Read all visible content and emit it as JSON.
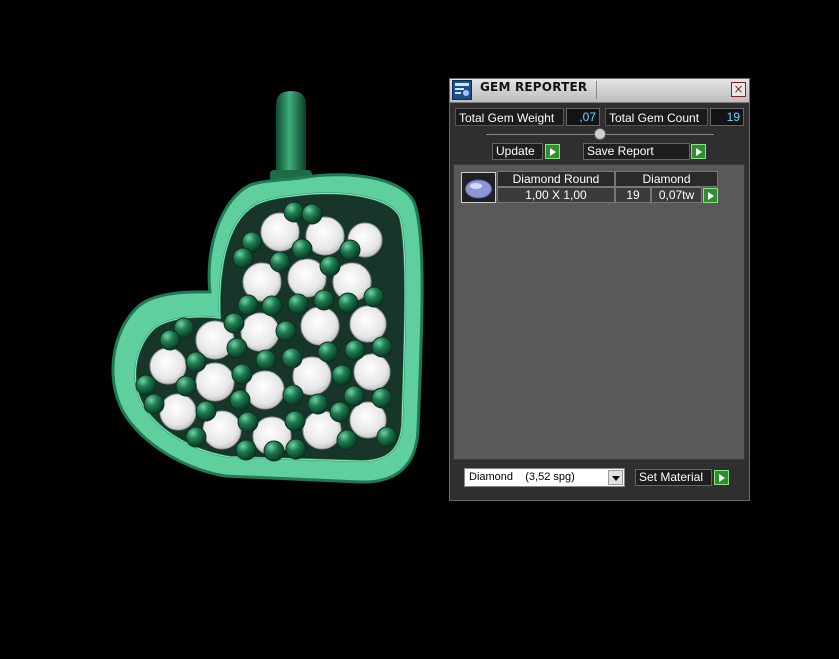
{
  "panel": {
    "title": "GEM REPORTER",
    "close_label": "×",
    "total_gem_weight_label": "Total Gem Weight",
    "total_gem_weight_value": ",07",
    "total_gem_count_label": "Total Gem Count",
    "total_gem_count_value": "19",
    "update_label": "Update",
    "save_report_label": "Save Report",
    "gem_table": {
      "headers": [
        "Diamond Round",
        "Diamond"
      ],
      "rows": [
        {
          "size": "1,00 X 1,00",
          "count": "19",
          "weight": "0,07tw"
        }
      ]
    },
    "material_select_value": "Diamond    (3,52 spg)",
    "set_material_label": "Set Material"
  },
  "viewport": {
    "metal_color": "#5fcf9f",
    "metal_dark": "#1f7a55",
    "bead_color": "#1e6a45",
    "gem_color": "#f2f2f2",
    "background": "#000000"
  }
}
